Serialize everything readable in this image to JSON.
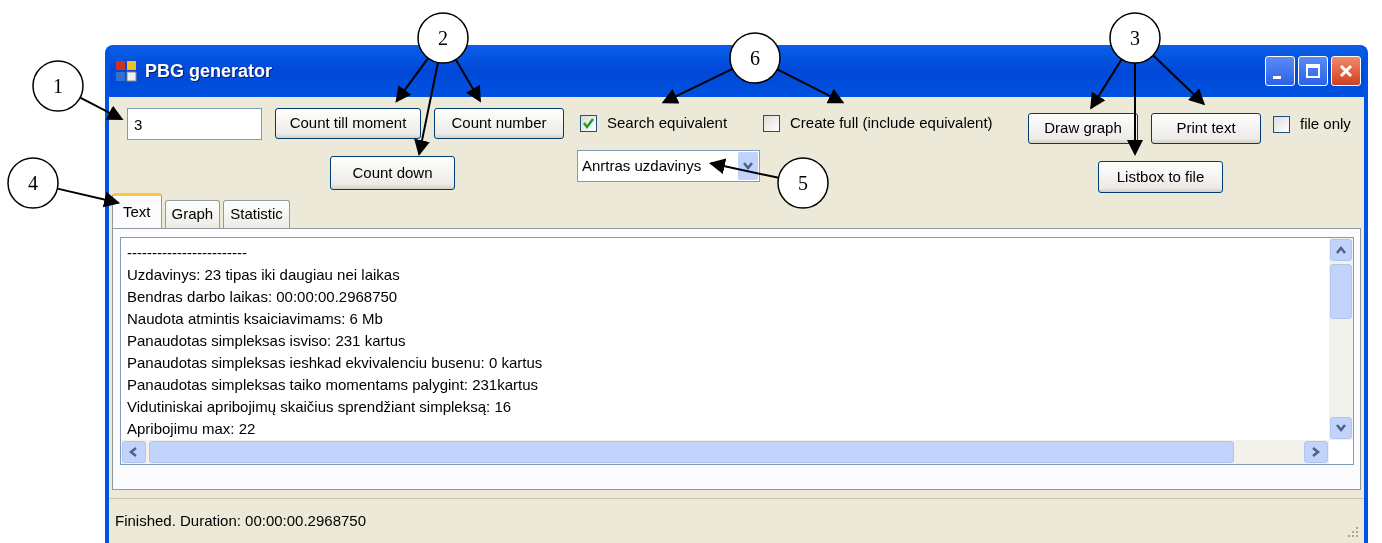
{
  "window": {
    "title": "PBG generator"
  },
  "number_field": {
    "value": "3"
  },
  "row1_buttons": [
    {
      "label": "Count till moment"
    },
    {
      "label": "Count number"
    }
  ],
  "count_down_button": {
    "label": "Count down"
  },
  "options": [
    {
      "label": "Search equivalent",
      "checked": true
    },
    {
      "label": "Create full (include equivalent)",
      "checked": false
    }
  ],
  "task_dropdown": {
    "value": "Anrtras uzdavinys"
  },
  "output_buttons": [
    {
      "label": "Draw graph"
    },
    {
      "label": "Print text"
    }
  ],
  "file_only": {
    "label": "file only",
    "checked": false
  },
  "listbox_to_file_button": {
    "label": "Listbox to file"
  },
  "tabs": [
    {
      "label": "Text",
      "selected": true
    },
    {
      "label": "Graph",
      "selected": false
    },
    {
      "label": "Statistic",
      "selected": false
    }
  ],
  "output_lines": [
    "------------------------",
    "Uzdavinys: 23 tipas iki daugiau nei laikas",
    "Bendras darbo laikas: 00:00:00.2968750",
    "Naudota atmintis ksaiciavimams: 6 Mb",
    "Panaudotas simpleksas isviso: 231 kartus",
    "Panaudotas simpleksas ieshkad ekvivalenciu busenu: 0 kartus",
    "Panaudotas simpleksas taiko momentams palygint: 231kartus",
    "Vidutiniskai apribojimų skaičius sprendžiant simpleksą: 16",
    "Apribojimu max: 22"
  ],
  "status_bar": "Finished. Duration: 00:00:00.2968750",
  "callouts": [
    {
      "label": "1"
    },
    {
      "label": "2"
    },
    {
      "label": "6"
    },
    {
      "label": "3"
    },
    {
      "label": "4"
    },
    {
      "label": "5"
    }
  ]
}
